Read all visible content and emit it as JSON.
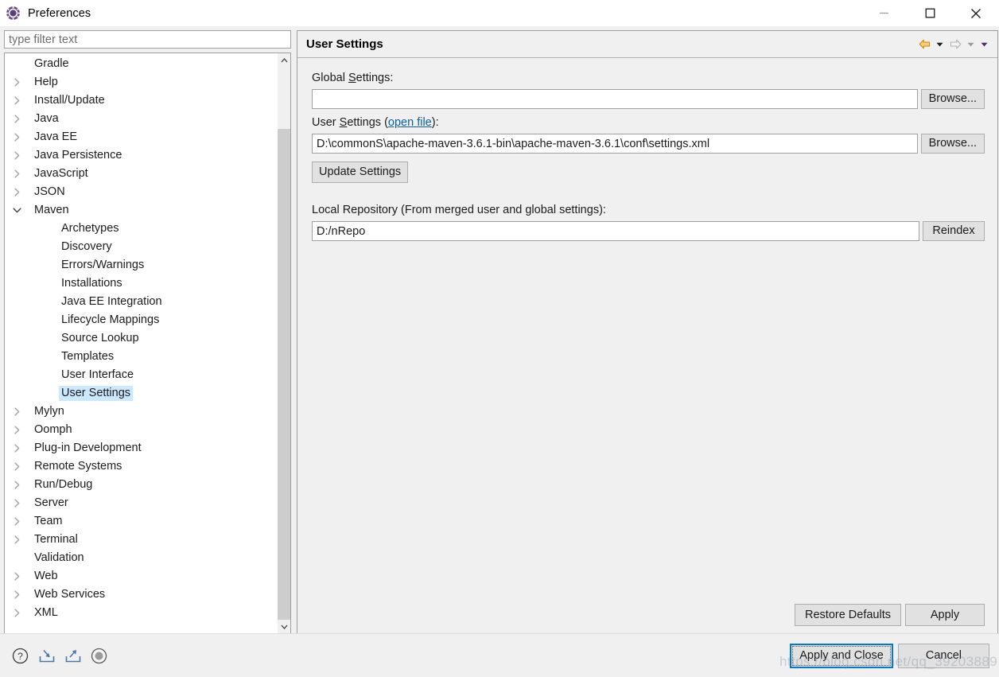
{
  "window": {
    "title": "Preferences",
    "app_icon": "gear-icon",
    "controls": {
      "minimize": "minimize-icon",
      "maximize": "maximize-icon",
      "close": "close-icon"
    }
  },
  "filter": {
    "placeholder": "type filter text",
    "value": ""
  },
  "tree": {
    "items": [
      {
        "label": "Gradle",
        "level": 0,
        "twisty": "none",
        "selected": false
      },
      {
        "label": "Help",
        "level": 0,
        "twisty": "collapsed",
        "selected": false
      },
      {
        "label": "Install/Update",
        "level": 0,
        "twisty": "collapsed",
        "selected": false
      },
      {
        "label": "Java",
        "level": 0,
        "twisty": "collapsed",
        "selected": false
      },
      {
        "label": "Java EE",
        "level": 0,
        "twisty": "collapsed",
        "selected": false
      },
      {
        "label": "Java Persistence",
        "level": 0,
        "twisty": "collapsed",
        "selected": false
      },
      {
        "label": "JavaScript",
        "level": 0,
        "twisty": "collapsed",
        "selected": false
      },
      {
        "label": "JSON",
        "level": 0,
        "twisty": "collapsed",
        "selected": false
      },
      {
        "label": "Maven",
        "level": 0,
        "twisty": "expanded",
        "selected": false
      },
      {
        "label": "Archetypes",
        "level": 2,
        "twisty": "none",
        "selected": false
      },
      {
        "label": "Discovery",
        "level": 2,
        "twisty": "none",
        "selected": false
      },
      {
        "label": "Errors/Warnings",
        "level": 2,
        "twisty": "none",
        "selected": false
      },
      {
        "label": "Installations",
        "level": 2,
        "twisty": "none",
        "selected": false
      },
      {
        "label": "Java EE Integration",
        "level": 2,
        "twisty": "none",
        "selected": false
      },
      {
        "label": "Lifecycle Mappings",
        "level": 2,
        "twisty": "none",
        "selected": false
      },
      {
        "label": "Source Lookup",
        "level": 2,
        "twisty": "none",
        "selected": false
      },
      {
        "label": "Templates",
        "level": 2,
        "twisty": "none",
        "selected": false
      },
      {
        "label": "User Interface",
        "level": 2,
        "twisty": "none",
        "selected": false
      },
      {
        "label": "User Settings",
        "level": 2,
        "twisty": "none",
        "selected": true
      },
      {
        "label": "Mylyn",
        "level": 0,
        "twisty": "collapsed",
        "selected": false
      },
      {
        "label": "Oomph",
        "level": 0,
        "twisty": "collapsed",
        "selected": false
      },
      {
        "label": "Plug-in Development",
        "level": 0,
        "twisty": "collapsed",
        "selected": false
      },
      {
        "label": "Remote Systems",
        "level": 0,
        "twisty": "collapsed",
        "selected": false
      },
      {
        "label": "Run/Debug",
        "level": 0,
        "twisty": "collapsed",
        "selected": false
      },
      {
        "label": "Server",
        "level": 0,
        "twisty": "collapsed",
        "selected": false
      },
      {
        "label": "Team",
        "level": 0,
        "twisty": "collapsed",
        "selected": false
      },
      {
        "label": "Terminal",
        "level": 0,
        "twisty": "collapsed",
        "selected": false
      },
      {
        "label": "Validation",
        "level": 0,
        "twisty": "none",
        "selected": false
      },
      {
        "label": "Web",
        "level": 0,
        "twisty": "collapsed",
        "selected": false
      },
      {
        "label": "Web Services",
        "level": 0,
        "twisty": "collapsed",
        "selected": false
      },
      {
        "label": "XML",
        "level": 0,
        "twisty": "collapsed",
        "selected": false
      }
    ]
  },
  "page": {
    "title": "User Settings",
    "nav": {
      "back": "back-arrow-icon",
      "back_menu": "dropdown-caret-icon",
      "forward": "forward-arrow-icon",
      "forward_menu": "dropdown-caret-icon",
      "view_menu": "dropdown-caret-icon"
    },
    "global_settings": {
      "label": "Global Settings:",
      "label_prefix": "Global ",
      "label_mnemonic": "S",
      "label_suffix": "ettings:",
      "value": "",
      "browse_label": "Browse..."
    },
    "user_settings": {
      "label_prefix": "User ",
      "label_mnemonic": "S",
      "label_mid": "ettings (",
      "link_label": "open file",
      "label_suffix": "):",
      "value": "D:\\commonS\\apache-maven-3.6.1-bin\\apache-maven-3.6.1\\conf\\settings.xml",
      "browse_label": "Browse...",
      "update_label": "Update Settings"
    },
    "local_repository": {
      "label": "Local Repository (From merged user and global settings):",
      "value": "D:/nRepo",
      "reindex_label": "Reindex"
    },
    "restore_defaults_label": "Restore Defaults",
    "apply_label": "Apply"
  },
  "footer": {
    "icons": [
      {
        "name": "help-icon"
      },
      {
        "name": "import-icon"
      },
      {
        "name": "export-icon"
      },
      {
        "name": "oomph-record-icon"
      }
    ],
    "apply_and_close_label": "Apply and Close",
    "cancel_label": "Cancel"
  },
  "watermark": {
    "text": "https://blog.csdn.net/qq_39203889"
  }
}
